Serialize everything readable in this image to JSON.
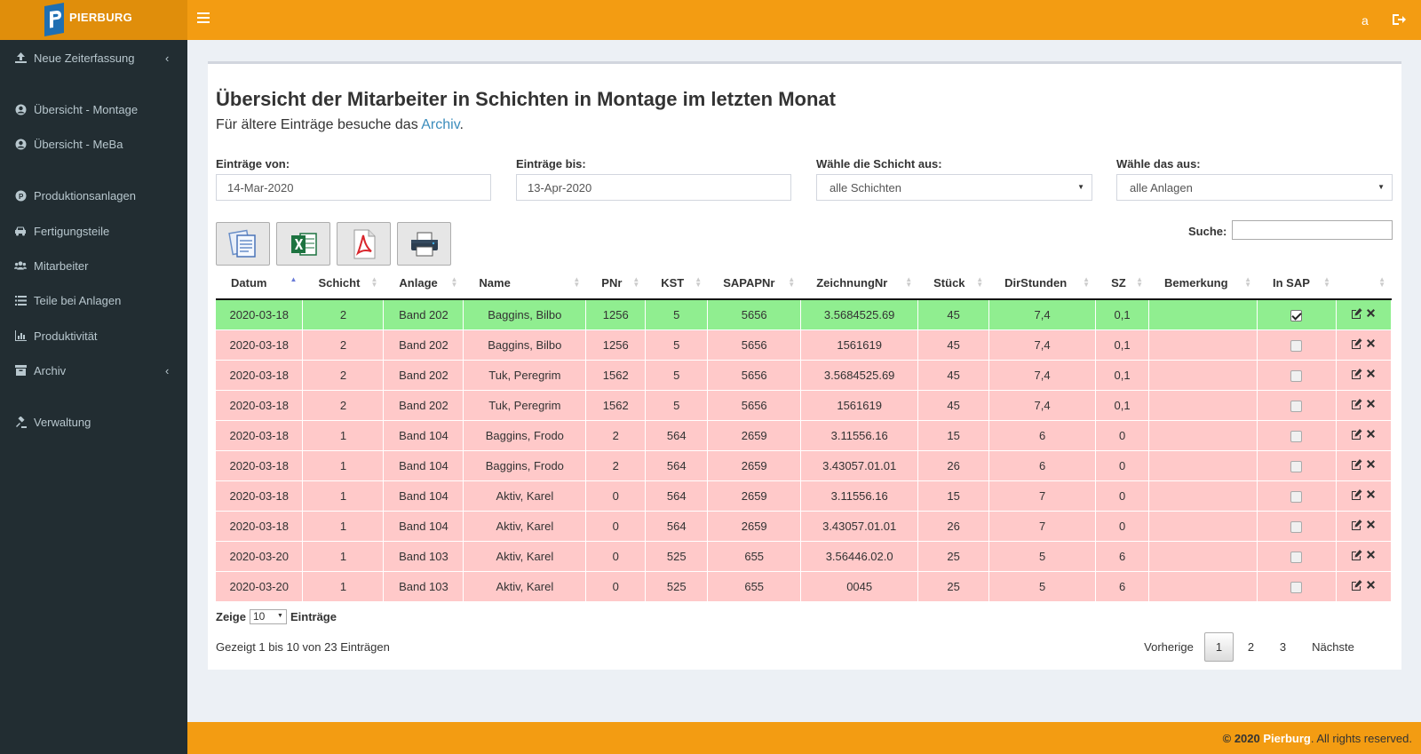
{
  "brand": {
    "logo_text": "PIERBURG"
  },
  "header": {
    "user": "a",
    "menu_icon": "hamburger-icon",
    "logout_icon": "sign-out-icon"
  },
  "sidebar": {
    "items": [
      {
        "label": "Neue Zeiterfassung",
        "icon": "upload-icon",
        "chevron": "‹"
      },
      {
        "label": "Übersicht - Montage",
        "icon": "user-circle-icon"
      },
      {
        "label": "Übersicht - MeBa",
        "icon": "user-circle-icon"
      },
      {
        "label": "Produktionsanlagen",
        "icon": "p-circle-icon"
      },
      {
        "label": "Fertigungsteile",
        "icon": "car-icon"
      },
      {
        "label": "Mitarbeiter",
        "icon": "users-icon"
      },
      {
        "label": "Teile bei Anlagen",
        "icon": "list-icon"
      },
      {
        "label": "Produktivität",
        "icon": "bar-chart-icon"
      },
      {
        "label": "Archiv",
        "icon": "archive-icon",
        "chevron": "‹"
      },
      {
        "label": "Verwaltung",
        "icon": "gavel-icon"
      }
    ]
  },
  "page": {
    "title": "Übersicht der Mitarbeiter in Schichten in Montage im letzten Monat",
    "subtitle_prefix": "Für ältere Einträge besuche das ",
    "subtitle_link": "Archiv",
    "subtitle_suffix": "."
  },
  "filters": {
    "from_label": "Einträge von:",
    "from_value": "14-Mar-2020",
    "to_label": "Einträge bis:",
    "to_value": "13-Apr-2020",
    "shift_label": "Wähle die Schicht aus:",
    "shift_value": "alle Schichten",
    "plant_label": "Wähle das aus:",
    "plant_value": "alle Anlagen"
  },
  "export_buttons": [
    "copy-icon",
    "excel-icon",
    "pdf-icon",
    "print-icon"
  ],
  "search": {
    "label": "Suche:",
    "value": ""
  },
  "table": {
    "columns": [
      "Datum",
      "Schicht",
      "Anlage",
      "Name",
      "PNr",
      "KST",
      "SAPAPNr",
      "ZeichnungNr",
      "Stück",
      "DirStunden",
      "SZ",
      "Bemerkung",
      "In SAP",
      ""
    ],
    "rows": [
      {
        "status": "green",
        "cells": [
          "2020-03-18",
          "2",
          "Band 202",
          "Baggins, Bilbo",
          "1256",
          "5",
          "5656",
          "3.5684525.69",
          "45",
          "7,4",
          "0,1",
          ""
        ],
        "in_sap": true
      },
      {
        "status": "red",
        "cells": [
          "2020-03-18",
          "2",
          "Band 202",
          "Baggins, Bilbo",
          "1256",
          "5",
          "5656",
          "1561619",
          "45",
          "7,4",
          "0,1",
          ""
        ],
        "in_sap": false
      },
      {
        "status": "red",
        "cells": [
          "2020-03-18",
          "2",
          "Band 202",
          "Tuk, Peregrim",
          "1562",
          "5",
          "5656",
          "3.5684525.69",
          "45",
          "7,4",
          "0,1",
          ""
        ],
        "in_sap": false
      },
      {
        "status": "red",
        "cells": [
          "2020-03-18",
          "2",
          "Band 202",
          "Tuk, Peregrim",
          "1562",
          "5",
          "5656",
          "1561619",
          "45",
          "7,4",
          "0,1",
          ""
        ],
        "in_sap": false
      },
      {
        "status": "red",
        "cells": [
          "2020-03-18",
          "1",
          "Band 104",
          "Baggins, Frodo",
          "2",
          "564",
          "2659",
          "3.11556.16",
          "15",
          "6",
          "0",
          ""
        ],
        "in_sap": false
      },
      {
        "status": "red",
        "cells": [
          "2020-03-18",
          "1",
          "Band 104",
          "Baggins, Frodo",
          "2",
          "564",
          "2659",
          "3.43057.01.01",
          "26",
          "6",
          "0",
          ""
        ],
        "in_sap": false
      },
      {
        "status": "red",
        "cells": [
          "2020-03-18",
          "1",
          "Band 104",
          "Aktiv, Karel",
          "0",
          "564",
          "2659",
          "3.11556.16",
          "15",
          "7",
          "0",
          ""
        ],
        "in_sap": false
      },
      {
        "status": "red",
        "cells": [
          "2020-03-18",
          "1",
          "Band 104",
          "Aktiv, Karel",
          "0",
          "564",
          "2659",
          "3.43057.01.01",
          "26",
          "7",
          "0",
          ""
        ],
        "in_sap": false
      },
      {
        "status": "red",
        "cells": [
          "2020-03-20",
          "1",
          "Band 103",
          "Aktiv, Karel",
          "0",
          "525",
          "655",
          "3.56446.02.0",
          "25",
          "5",
          "6",
          ""
        ],
        "in_sap": false
      },
      {
        "status": "red",
        "cells": [
          "2020-03-20",
          "1",
          "Band 103",
          "Aktiv, Karel",
          "0",
          "525",
          "655",
          "0045",
          "25",
          "5",
          "6",
          ""
        ],
        "in_sap": false
      }
    ]
  },
  "length": {
    "prefix": "Zeige",
    "value": "10",
    "suffix": "Einträge"
  },
  "info": "Gezeigt 1 bis 10 von 23 Einträgen",
  "pagination": {
    "prev": "Vorherige",
    "pages": [
      "1",
      "2",
      "3"
    ],
    "next": "Nächste",
    "current": "1"
  },
  "footer": {
    "prefix": "© 2020 ",
    "brand": "Pierburg",
    "suffix": ". All rights reserved."
  },
  "colors": {
    "header": "#f39c12",
    "sidebar": "#222d32",
    "row_ok": "#90ee90",
    "row_pending": "#ffc9c9",
    "link": "#3c8dbc"
  }
}
